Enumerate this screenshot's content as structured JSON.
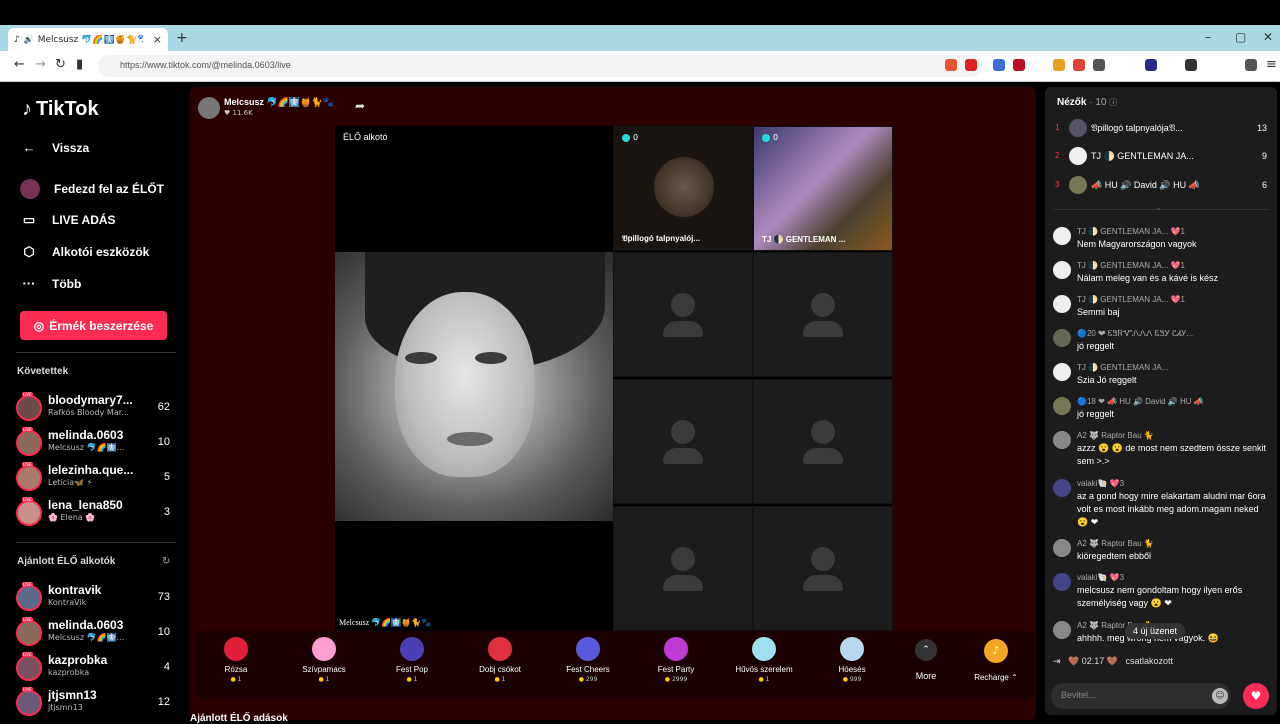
{
  "browser": {
    "tab_title": "Melcsusz 🐬🌈🩻🍯🐈🐾🎀",
    "url": "https://www.tiktok.com/@melinda.0603/live"
  },
  "sidebar": {
    "logo": "TikTok",
    "nav": [
      {
        "label": "Vissza",
        "icon": "arrow-left-icon"
      },
      {
        "label": "Fedezd fel az ÉLŐT",
        "icon": "avatar"
      },
      {
        "label": "LIVE ADÁS",
        "icon": "camera-icon"
      },
      {
        "label": "Alkotói eszközök",
        "icon": "tools-icon"
      },
      {
        "label": "Több",
        "icon": "more-icon"
      }
    ],
    "coins_button": "Érmék beszerzése",
    "following_title": "Követettek",
    "following": [
      {
        "name": "bloodymary7...",
        "sub": "Rafkós Bloody Mar...",
        "count": "62"
      },
      {
        "name": "melinda.0603",
        "sub": "Melcsusz 🐬🌈🩻...",
        "count": "10"
      },
      {
        "name": "lelezinha.que...",
        "sub": "Leticia🦋 ⚡",
        "count": "5"
      },
      {
        "name": "lena_lena850",
        "sub": "🌸 Elena 🌸",
        "count": "3"
      }
    ],
    "recommended_title": "Ajánlott ÉLŐ alkotók",
    "recommended": [
      {
        "name": "kontravik",
        "sub": "KontraVik",
        "count": "73"
      },
      {
        "name": "melinda.0603",
        "sub": "Melcsusz 🐬🌈🩻...",
        "count": "10"
      },
      {
        "name": "kazprobka",
        "sub": "kazprobka",
        "count": "4"
      },
      {
        "name": "jtjsmn13",
        "sub": "jtjsmn13",
        "count": "12"
      }
    ]
  },
  "stream": {
    "host_name": "Melcsusz 🐬🌈🩻🍯🐈🐾",
    "host_likes": "♥ 11.6K",
    "live_creator_label": "ÉLŐ alkotó",
    "host_caption": "Melcsusz 🐬🌈🩻🍯🐈🐾",
    "guests": [
      {
        "name": "𝔙pillogó talpnyalój...",
        "count": "0"
      },
      {
        "name": "TJ 🌓 GENTLEMAN ...",
        "count": "0"
      }
    ],
    "below_text": "Ajánlott ÉLŐ adások"
  },
  "gifts": [
    {
      "name": "Rózsa",
      "price": "1",
      "color": "#e0203a"
    },
    {
      "name": "Szívpamacs",
      "price": "1",
      "color": "#ff9fd1"
    },
    {
      "name": "Fest Pop",
      "price": "1",
      "color": "#4a3fb5"
    },
    {
      "name": "Dobj csókot",
      "price": "1",
      "color": "#e03040"
    },
    {
      "name": "Fest Cheers",
      "price": "299",
      "color": "#5a5adf"
    },
    {
      "name": "Fest Party",
      "price": "2999",
      "color": "#c03ad8"
    },
    {
      "name": "Hűvös szerelem",
      "price": "1",
      "color": "#9fe0f0"
    },
    {
      "name": "Hóesés",
      "price": "999",
      "color": "#b7d8f0"
    }
  ],
  "gift_more": "More",
  "recharge": "Recharge ⌃",
  "chat": {
    "viewers_title": "Nézők",
    "viewers_count": "· 10",
    "top_viewers": [
      {
        "rank": "1",
        "name": "𝔙pillogó talpnyalója𝔙...",
        "score": "13"
      },
      {
        "rank": "2",
        "name": "TJ 🌓 GENTLEMAN JA...",
        "score": "9"
      },
      {
        "rank": "3",
        "name": "📣 HU 🔊 David 🔊 HU 📣",
        "score": "6"
      }
    ],
    "messages": [
      {
        "user": "TJ 🌓 GENTLEMAN JA... 💖1",
        "text": "Nem Magyarországon vagyok"
      },
      {
        "user": "TJ 🌓 GENTLEMAN JA... 💖1",
        "text": "Nálam meleg van és a kávé is kész"
      },
      {
        "user": "TJ 🌓 GENTLEMAN JA... 💖1",
        "text": "Semmi baj"
      },
      {
        "user": "🔵20 ❤ ᏋᏕᏒᏉᏁᏁᏁ ᏋᏕᎩ ᏝᏗᎩ...",
        "text": "jó reggelt"
      },
      {
        "user": "TJ 🌓 GENTLEMAN JA...",
        "text": "Szia Jó reggelt"
      },
      {
        "user": "🔵18 ❤ 📣 HU 🔊 David 🔊 HU 📣",
        "text": "jó reggelt"
      },
      {
        "user": "A2 🐺 Raptor Bau 🐈",
        "text": "azzz 😮 😮 de most nem szedtem össze senkit sem >.>"
      },
      {
        "user": "valaki🐚 💖3",
        "text": "az a gond hogy mire elakartam aludni mar 6ora volt es most inkább meg adom.magam neked 😮 ❤"
      },
      {
        "user": "A2 🐺 Raptor Bau 🐈",
        "text": "kiöregedtem ebből"
      },
      {
        "user": "valaki🐚 💖3",
        "text": "melcsusz nem gondoltam hogy ilyen erős személyiség vagy 😮 ❤"
      },
      {
        "user": "A2 🐺 Raptor Bau 🐈",
        "text": "ahhhh. meg wrong nem vagyok. 😆"
      }
    ],
    "new_messages": "4 új üzenet",
    "joined_user": "🤎 02.17 🤎",
    "joined_text": "csatlakozott",
    "input_placeholder": "Bevitel..."
  }
}
